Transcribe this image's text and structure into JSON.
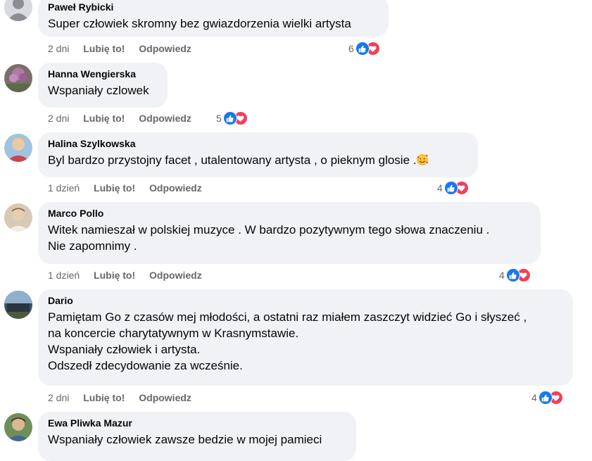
{
  "comments": [
    {
      "author": "Paweł Rybicki",
      "lines": [
        "Super człowiek skromny bez gwiazdorzenia wielki artysta"
      ],
      "time": "2 dni",
      "like_label": "Lubię to!",
      "reply_label": "Odpowiedz",
      "reaction_count": "6",
      "reactions": [
        "like",
        "love"
      ]
    },
    {
      "author": "Hanna Wengierska",
      "lines": [
        "Wspaniały czlowek"
      ],
      "time": "2 dni",
      "like_label": "Lubię to!",
      "reply_label": "Odpowiedz",
      "reaction_count": "5",
      "reactions": [
        "like",
        "love"
      ]
    },
    {
      "author": "Halina Szylkowska",
      "lines": [
        "Byl bardzo przystojny facet , utalentowany artysta , o pieknym glosie ."
      ],
      "emoji": "smiling-face-with-hearts",
      "time": "1 dzień",
      "like_label": "Lubię to!",
      "reply_label": "Odpowiedz",
      "reaction_count": "4",
      "reactions": [
        "like",
        "love"
      ]
    },
    {
      "author": "Marco Pollo",
      "lines": [
        "Witek namieszał w polskiej muzyce . W bardzo pozytywnym tego słowa znaczeniu .",
        "Nie zapomnimy ."
      ],
      "time": "1 dzień",
      "like_label": "Lubię to!",
      "reply_label": "Odpowiedz",
      "reaction_count": "4",
      "reactions": [
        "like",
        "love"
      ]
    },
    {
      "author": "Dario",
      "lines": [
        "Pamiętam Go z czasów mej młodości, a ostatni raz miałem zaszczyt widzieć Go i słyszeć ,",
        "na koncercie charytatywnym w Krasnymstawie.",
        "Wspaniały człowiek i artysta.",
        "Odszedł zdecydowanie za wcześnie."
      ],
      "time": "2 dni",
      "like_label": "Lubię to!",
      "reply_label": "Odpowiedz",
      "reaction_count": "4",
      "reactions": [
        "like",
        "love"
      ]
    },
    {
      "author": "Ewa Pliwka Mazur",
      "lines": [
        "Wspaniały człowiek zawsze bedzie w mojej pamieci"
      ]
    }
  ],
  "colors": {
    "bubble": "#f0f2f5",
    "like_blue": "#1877f2",
    "love_red": "#f33e58",
    "meta_gray": "#65676b"
  },
  "icons": {
    "like": "thumbs-up-icon",
    "love": "heart-icon"
  }
}
